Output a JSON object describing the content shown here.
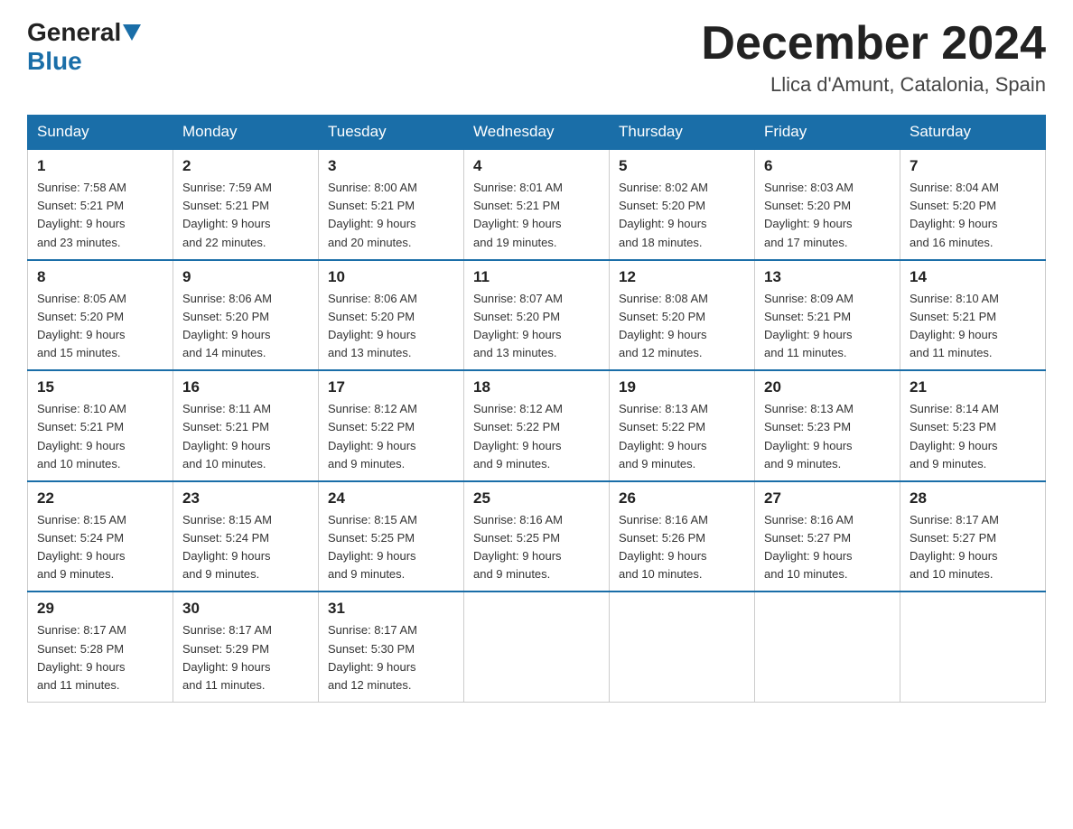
{
  "header": {
    "logo": {
      "part1": "General",
      "part2": "Blue"
    },
    "title": "December 2024",
    "location": "Llica d'Amunt, Catalonia, Spain"
  },
  "days_of_week": [
    "Sunday",
    "Monday",
    "Tuesday",
    "Wednesday",
    "Thursday",
    "Friday",
    "Saturday"
  ],
  "weeks": [
    [
      {
        "day": "1",
        "sunrise": "7:58 AM",
        "sunset": "5:21 PM",
        "daylight": "9 hours and 23 minutes."
      },
      {
        "day": "2",
        "sunrise": "7:59 AM",
        "sunset": "5:21 PM",
        "daylight": "9 hours and 22 minutes."
      },
      {
        "day": "3",
        "sunrise": "8:00 AM",
        "sunset": "5:21 PM",
        "daylight": "9 hours and 20 minutes."
      },
      {
        "day": "4",
        "sunrise": "8:01 AM",
        "sunset": "5:21 PM",
        "daylight": "9 hours and 19 minutes."
      },
      {
        "day": "5",
        "sunrise": "8:02 AM",
        "sunset": "5:20 PM",
        "daylight": "9 hours and 18 minutes."
      },
      {
        "day": "6",
        "sunrise": "8:03 AM",
        "sunset": "5:20 PM",
        "daylight": "9 hours and 17 minutes."
      },
      {
        "day": "7",
        "sunrise": "8:04 AM",
        "sunset": "5:20 PM",
        "daylight": "9 hours and 16 minutes."
      }
    ],
    [
      {
        "day": "8",
        "sunrise": "8:05 AM",
        "sunset": "5:20 PM",
        "daylight": "9 hours and 15 minutes."
      },
      {
        "day": "9",
        "sunrise": "8:06 AM",
        "sunset": "5:20 PM",
        "daylight": "9 hours and 14 minutes."
      },
      {
        "day": "10",
        "sunrise": "8:06 AM",
        "sunset": "5:20 PM",
        "daylight": "9 hours and 13 minutes."
      },
      {
        "day": "11",
        "sunrise": "8:07 AM",
        "sunset": "5:20 PM",
        "daylight": "9 hours and 13 minutes."
      },
      {
        "day": "12",
        "sunrise": "8:08 AM",
        "sunset": "5:20 PM",
        "daylight": "9 hours and 12 minutes."
      },
      {
        "day": "13",
        "sunrise": "8:09 AM",
        "sunset": "5:21 PM",
        "daylight": "9 hours and 11 minutes."
      },
      {
        "day": "14",
        "sunrise": "8:10 AM",
        "sunset": "5:21 PM",
        "daylight": "9 hours and 11 minutes."
      }
    ],
    [
      {
        "day": "15",
        "sunrise": "8:10 AM",
        "sunset": "5:21 PM",
        "daylight": "9 hours and 10 minutes."
      },
      {
        "day": "16",
        "sunrise": "8:11 AM",
        "sunset": "5:21 PM",
        "daylight": "9 hours and 10 minutes."
      },
      {
        "day": "17",
        "sunrise": "8:12 AM",
        "sunset": "5:22 PM",
        "daylight": "9 hours and 9 minutes."
      },
      {
        "day": "18",
        "sunrise": "8:12 AM",
        "sunset": "5:22 PM",
        "daylight": "9 hours and 9 minutes."
      },
      {
        "day": "19",
        "sunrise": "8:13 AM",
        "sunset": "5:22 PM",
        "daylight": "9 hours and 9 minutes."
      },
      {
        "day": "20",
        "sunrise": "8:13 AM",
        "sunset": "5:23 PM",
        "daylight": "9 hours and 9 minutes."
      },
      {
        "day": "21",
        "sunrise": "8:14 AM",
        "sunset": "5:23 PM",
        "daylight": "9 hours and 9 minutes."
      }
    ],
    [
      {
        "day": "22",
        "sunrise": "8:15 AM",
        "sunset": "5:24 PM",
        "daylight": "9 hours and 9 minutes."
      },
      {
        "day": "23",
        "sunrise": "8:15 AM",
        "sunset": "5:24 PM",
        "daylight": "9 hours and 9 minutes."
      },
      {
        "day": "24",
        "sunrise": "8:15 AM",
        "sunset": "5:25 PM",
        "daylight": "9 hours and 9 minutes."
      },
      {
        "day": "25",
        "sunrise": "8:16 AM",
        "sunset": "5:25 PM",
        "daylight": "9 hours and 9 minutes."
      },
      {
        "day": "26",
        "sunrise": "8:16 AM",
        "sunset": "5:26 PM",
        "daylight": "9 hours and 10 minutes."
      },
      {
        "day": "27",
        "sunrise": "8:16 AM",
        "sunset": "5:27 PM",
        "daylight": "9 hours and 10 minutes."
      },
      {
        "day": "28",
        "sunrise": "8:17 AM",
        "sunset": "5:27 PM",
        "daylight": "9 hours and 10 minutes."
      }
    ],
    [
      {
        "day": "29",
        "sunrise": "8:17 AM",
        "sunset": "5:28 PM",
        "daylight": "9 hours and 11 minutes."
      },
      {
        "day": "30",
        "sunrise": "8:17 AM",
        "sunset": "5:29 PM",
        "daylight": "9 hours and 11 minutes."
      },
      {
        "day": "31",
        "sunrise": "8:17 AM",
        "sunset": "5:30 PM",
        "daylight": "9 hours and 12 minutes."
      },
      null,
      null,
      null,
      null
    ]
  ],
  "labels": {
    "sunrise": "Sunrise:",
    "sunset": "Sunset:",
    "daylight": "Daylight:"
  }
}
